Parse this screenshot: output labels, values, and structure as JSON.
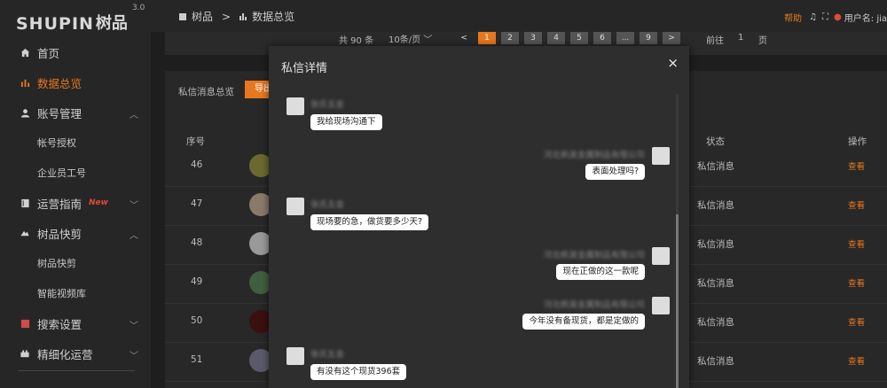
{
  "app": {
    "brand": "SHUPIN",
    "brand_cn": "树品",
    "version": "3.0"
  },
  "sidebar": {
    "items": [
      {
        "label": "首页",
        "icon": "home-icon"
      },
      {
        "label": "数据总览",
        "icon": "bar-chart-icon"
      },
      {
        "label": "账号管理",
        "icon": "user-icon"
      },
      {
        "label": "帐号授权"
      },
      {
        "label": "企业员工号"
      },
      {
        "label": "运营指南",
        "icon": "book-icon",
        "badge": "New"
      },
      {
        "label": "树品快剪",
        "icon": "scissors-icon"
      },
      {
        "label": "树品快剪"
      },
      {
        "label": "智能视频库"
      },
      {
        "label": "搜索设置",
        "icon": "search-settings-icon"
      },
      {
        "label": "精细化运营",
        "icon": "tune-icon"
      }
    ]
  },
  "topbar": {
    "crumb_root": "树品",
    "crumb_sep": ">",
    "crumb_current": "数据总览",
    "help": "帮助",
    "user_label": "用户名: jia"
  },
  "pager": {
    "total": "共 90 条",
    "per_page": "10条/页",
    "prev": "<",
    "next": ">",
    "pages": [
      "1",
      "2",
      "3",
      "4",
      "5",
      "6",
      "...",
      "9"
    ],
    "goto_label": "前往",
    "goto_value": "1",
    "goto_unit": "页"
  },
  "panel": {
    "title": "私信消息总览",
    "export_label": "导出",
    "headers": {
      "index": "序号",
      "status": "状态",
      "action": "操作"
    },
    "rows": [
      {
        "num": "46",
        "status": "私信消息",
        "action": "查看"
      },
      {
        "num": "47",
        "status": "私信消息",
        "action": "查看"
      },
      {
        "num": "48",
        "status": "私信消息",
        "action": "查看"
      },
      {
        "num": "49",
        "status": "私信消息",
        "action": "查看"
      },
      {
        "num": "50",
        "status": "私信消息",
        "action": "查看"
      },
      {
        "num": "51",
        "status": "私信消息",
        "action": "查看"
      }
    ]
  },
  "modal": {
    "title": "私信详情",
    "close": "×",
    "messages": [
      {
        "side": "left",
        "name": "张氏五金",
        "text": "我给现场沟通下"
      },
      {
        "side": "right",
        "name": "河北帆昊金属制品有限公司",
        "text": "表面处理吗?"
      },
      {
        "side": "left",
        "name": "张氏五金",
        "text": "现场要的急，做货要多少天?"
      },
      {
        "side": "right",
        "name": "河北帆昊金属制品有限公司",
        "text": "现在正做的这一款呢"
      },
      {
        "side": "right",
        "name": "河北帆昊金属制品有限公司",
        "text": "今年没有备现货，都是定做的"
      },
      {
        "side": "left",
        "name": "张氏五金",
        "text": "有没有这个现货396套"
      }
    ]
  },
  "colors": {
    "accent": "#e8781f",
    "background": "#1e1e1e",
    "sidebar": "#262626",
    "modal": "#2e2e2e"
  }
}
